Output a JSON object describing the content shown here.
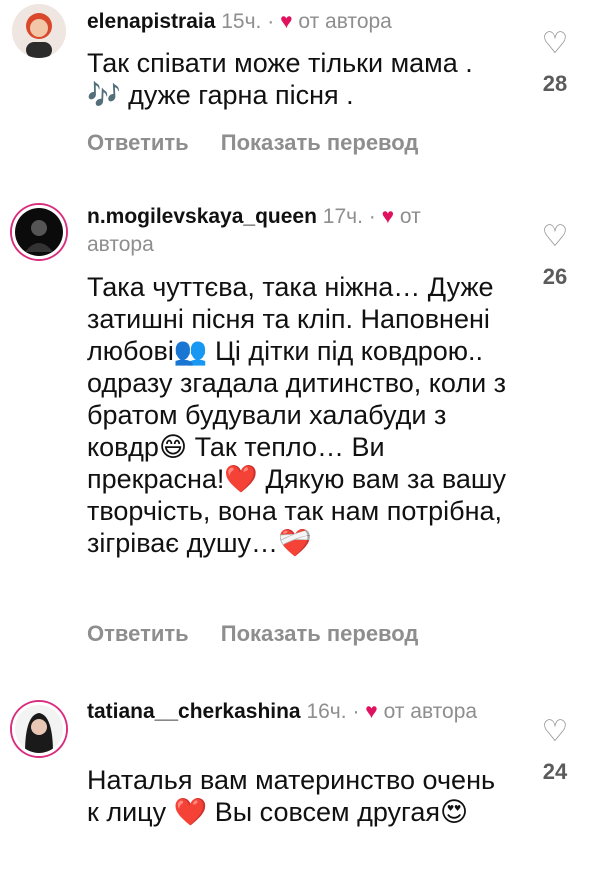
{
  "actions": {
    "reply": "Ответить",
    "translate": "Показать перевод"
  },
  "comments": [
    {
      "username": "elenapistraia",
      "time": "15ч.",
      "separator": "·",
      "author_badge": "от автора",
      "text": "Так співати  може тільки мама . 🎶 дуже гарна пісня .",
      "likes": "28"
    },
    {
      "username": "n.mogilevskaya_queen",
      "time": "17ч.",
      "separator": "·",
      "author_badge": "от автора",
      "text": "Така чуттєва, така ніжна… Дуже затишні пісня та кліп. Наповнені любові👥 Ці дітки під ковдрою.. одразу згадала дитинство, коли з братом будували халабуди з ковдр😄 Так тепло… Ви прекрасна!❤️ Дякую вам за вашу творчість, вона так нам потрібна, зігріває душу…❤️‍🩹",
      "likes": "26"
    },
    {
      "username": "tatiana__cherkashina",
      "time": "16ч.",
      "separator": "·",
      "author_badge": "от автора",
      "text": "Наталья вам материнство очень к лицу ❤️ Вы совсем другая😍",
      "likes": "24"
    }
  ],
  "icons": {
    "like": "heart-outline-icon",
    "author_like": "red-heart-icon"
  },
  "colors": {
    "author_heart": "#e0115f",
    "meta_gray": "#8e8e8e",
    "story_ring": "#d92e7f"
  }
}
